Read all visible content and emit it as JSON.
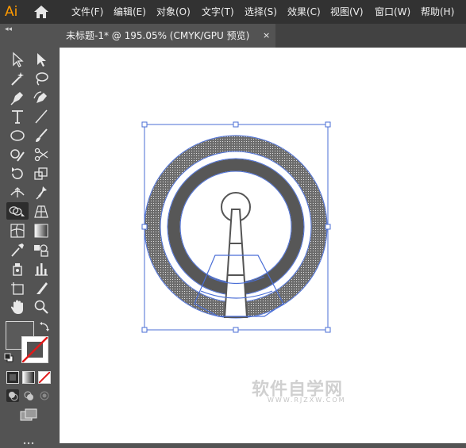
{
  "app": {
    "logo_text": "Ai",
    "menus": [
      "文件(F)",
      "编辑(E)",
      "对象(O)",
      "文字(T)",
      "选择(S)",
      "效果(C)",
      "视图(V)",
      "窗口(W)",
      "帮助(H)"
    ]
  },
  "document_tab": {
    "title": "未标题-1* @ 195.05% (CMYK/GPU 预览)",
    "close_glyph": "×"
  },
  "panel": {
    "collapse_glyph": "◂◂"
  },
  "tools": [
    "selection-tool",
    "direct-selection-tool",
    "magic-wand-tool",
    "lasso-tool",
    "pen-tool",
    "curvature-tool",
    "type-tool",
    "line-segment-tool",
    "ellipse-tool",
    "paintbrush-tool",
    "shaper-tool",
    "scissors-tool",
    "rotate-tool",
    "scale-tool",
    "width-tool",
    "puppet-warp-tool",
    "shape-builder-tool",
    "perspective-grid-tool",
    "mesh-tool",
    "gradient-tool",
    "eyedropper-tool",
    "blend-tool",
    "symbol-sprayer-tool",
    "column-graph-tool",
    "artboard-tool",
    "slice-tool",
    "hand-tool",
    "zoom-tool"
  ],
  "colors": {
    "menubar": "#323232",
    "panel": "#535353",
    "selection_blue": "#4a6ed6",
    "artwork_gray": "#555555",
    "fill_swatch": "#5a5a5a"
  },
  "watermark": {
    "text": "软件自学网",
    "sub": "WWW.RJZXW.COM"
  }
}
